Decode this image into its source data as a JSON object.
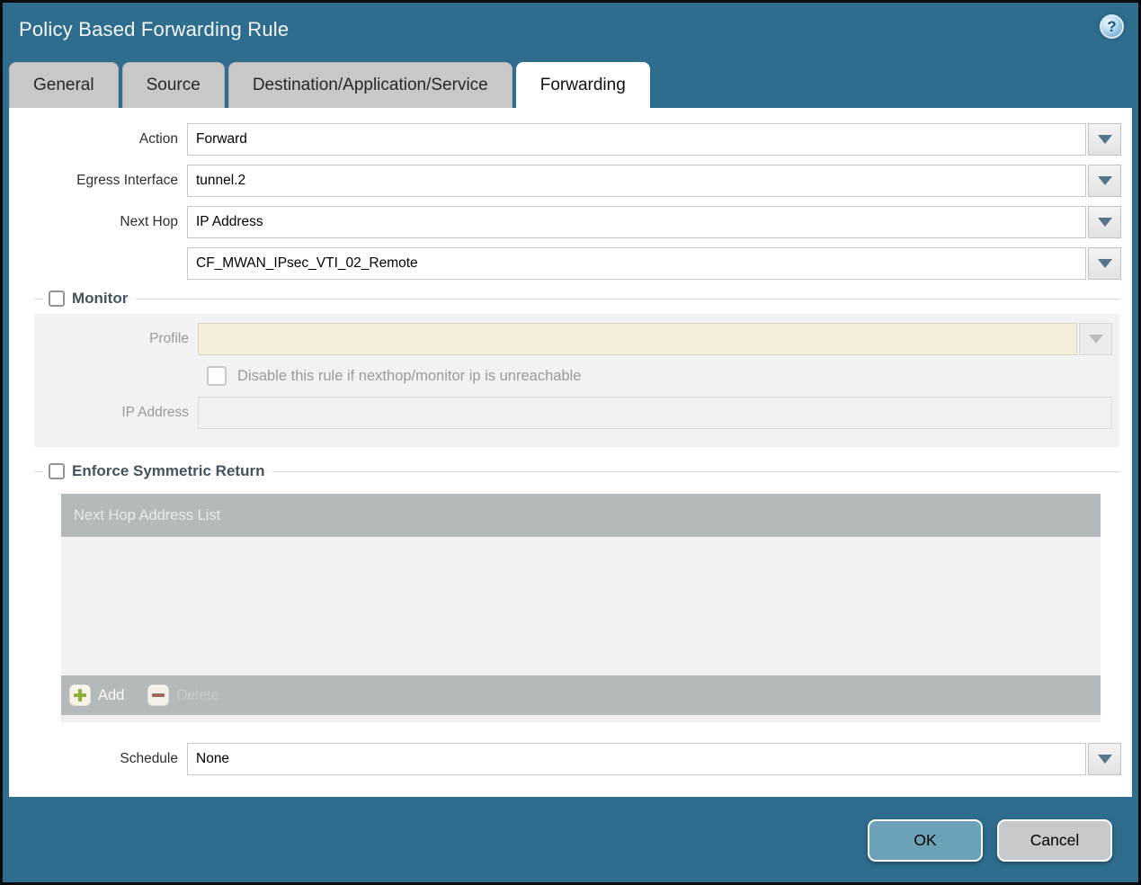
{
  "dialog": {
    "title": "Policy Based Forwarding Rule",
    "help_glyph": "?"
  },
  "tabs": [
    {
      "label": "General",
      "active": false
    },
    {
      "label": "Source",
      "active": false
    },
    {
      "label": "Destination/Application/Service",
      "active": false
    },
    {
      "label": "Forwarding",
      "active": true
    }
  ],
  "form": {
    "action": {
      "label": "Action",
      "value": "Forward"
    },
    "egress_interface": {
      "label": "Egress Interface",
      "value": "tunnel.2"
    },
    "next_hop": {
      "label": "Next Hop",
      "value": "IP Address"
    },
    "next_hop_address": {
      "value": "CF_MWAN_IPsec_VTI_02_Remote"
    },
    "monitor": {
      "label": "Monitor",
      "checked": false,
      "profile": {
        "label": "Profile",
        "value": ""
      },
      "disable_rule": {
        "label": "Disable this rule if nexthop/monitor ip is unreachable",
        "checked": false
      },
      "ip_address": {
        "label": "IP Address",
        "value": ""
      }
    },
    "enforce_symmetric_return": {
      "label": "Enforce Symmetric Return",
      "checked": false,
      "table": {
        "header": "Next Hop Address List",
        "rows": [],
        "add_label": "Add",
        "delete_label": "Delete"
      }
    },
    "schedule": {
      "label": "Schedule",
      "value": "None"
    }
  },
  "footer": {
    "ok_label": "OK",
    "cancel_label": "Cancel"
  },
  "colors": {
    "titlebar_teal": "#2e6d8e",
    "ok_button": "#6ba2b8",
    "cancel_button": "#c6c9cb",
    "table_header_gray": "#b4b9bc",
    "disabled_input_beige": "#f3eeda",
    "panel_gray": "#f2f2f2",
    "add_plus_green": "#8fae3a",
    "delete_minus_red": "#a2655f"
  }
}
